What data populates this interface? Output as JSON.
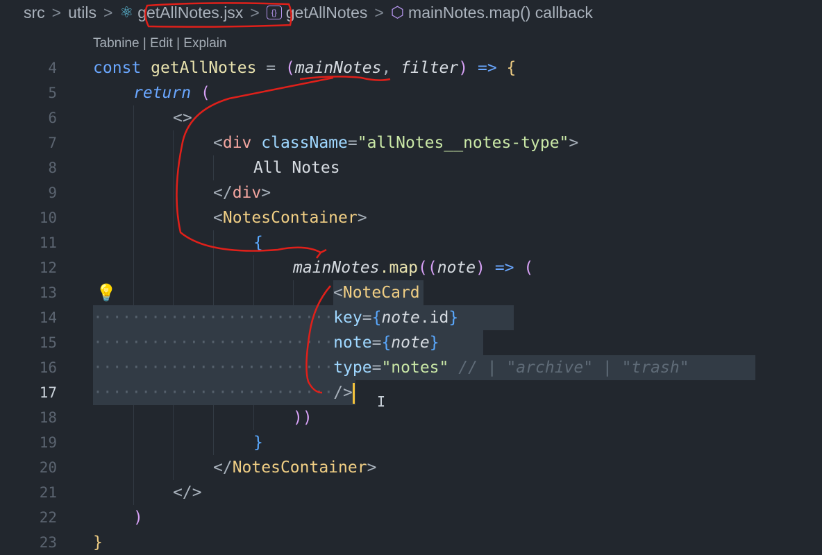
{
  "breadcrumb": {
    "items": [
      "src",
      "utils",
      "getAllNotes.jsx",
      "getAllNotes",
      "mainNotes.map() callback"
    ],
    "separator": ">"
  },
  "codelens": {
    "text": "Tabnine | Edit | Explain"
  },
  "editor": {
    "active_line": "17",
    "lines": [
      {
        "n": "4"
      },
      {
        "n": "5"
      },
      {
        "n": "6"
      },
      {
        "n": "7"
      },
      {
        "n": "8"
      },
      {
        "n": "9"
      },
      {
        "n": "10"
      },
      {
        "n": "11"
      },
      {
        "n": "12"
      },
      {
        "n": "13"
      },
      {
        "n": "14"
      },
      {
        "n": "15"
      },
      {
        "n": "16"
      },
      {
        "n": "17"
      },
      {
        "n": "18"
      },
      {
        "n": "19"
      },
      {
        "n": "20"
      },
      {
        "n": "21"
      },
      {
        "n": "22"
      },
      {
        "n": "23"
      }
    ],
    "tokens": {
      "const": "const",
      "getAllNotes": "getAllNotes",
      "eq": " = ",
      "lp": "(",
      "mainNotes": "mainNotes",
      "comma": ", ",
      "filter": "filter",
      "rp": ")",
      "arrow": " => ",
      "lb": "{",
      "return": "return",
      "ret_paren": " (",
      "frag_open": "<>",
      "div_open_lt": "<",
      "div": "div",
      "className": " className",
      "eqs": "=",
      "cls_val": "\"allNotes__notes-type\"",
      "gt": ">",
      "all_notes": "All Notes",
      "div_close": "</",
      "nc_open_lt": "<",
      "NotesContainer": "NotesContainer",
      "brace_open": "{",
      "mainNotes2": "mainNotes",
      "dot_map": ".map",
      "paren2": "((",
      "note": "note",
      "paren_close": ")",
      "arrow2": " => ",
      "paren_open2": "(",
      "notecard_lt": "<",
      "NoteCard": "NoteCard",
      "key": "key",
      "note_id_a": "note",
      "note_id_b": ".id",
      "rb": "}",
      "note_attr": "note",
      "type_attr": "type",
      "notes_val": "\"notes\"",
      "comment": " // | \"archive\" | \"trash\"",
      "selfclose": "/>",
      "close_paren2": "))",
      "brace_close": "}",
      "nc_close": "</",
      "frag_close": "</>",
      "ret_close": ")",
      "fn_close": "}"
    },
    "dots_14": "·························",
    "dots_15": "·························",
    "dots_16": "·························",
    "dots_17": "·························"
  },
  "colors": {
    "background": "#22272e",
    "cursor": "#f5c33b",
    "annotation": "#e0201a"
  }
}
